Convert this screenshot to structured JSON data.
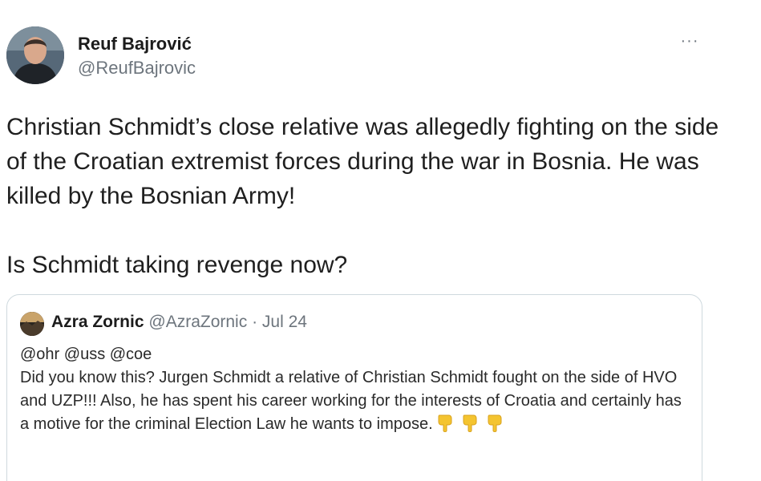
{
  "tweet": {
    "author": {
      "display_name": "Reuf Bajrović",
      "handle": "@ReufBajrovic"
    },
    "more_label": "···",
    "text_paragraph_1": "Christian Schmidt’s close relative was allegedly fighting on the side of the Croatian extremist forces during the war in Bosnia. He was killed by the Bosnian Army!",
    "text_paragraph_2": "Is Schmidt taking revenge now?",
    "quoted_tweet": {
      "display_name": "Azra Zornic",
      "handle": "@AzraZornic",
      "separator": "·",
      "date": "Jul 24",
      "mentions": "@ohr @uss @coe",
      "text": "Did you know this? Jurgen Schmidt a relative of Christian Schmidt fought on the side of HVO and UZP!!! Also, he has spent his career working for the interests of Croatia and certainly has a motive for the criminal Election Law he wants to impose.",
      "emoji_icons": [
        "pointing-down-hand-icon",
        "pointing-down-hand-icon",
        "pointing-down-hand-icon"
      ],
      "emoji_color": "#f4c430"
    }
  }
}
